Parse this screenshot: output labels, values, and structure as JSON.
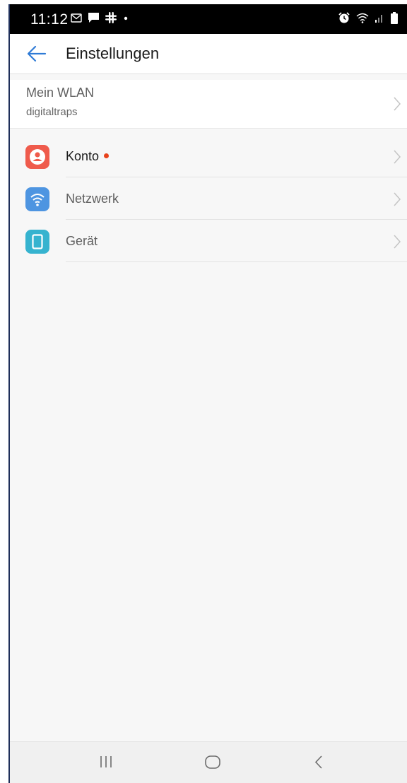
{
  "status_bar": {
    "time": "11:12",
    "left_icons": [
      "gmail-icon",
      "chat-icon",
      "slack-icon",
      "dot-icon"
    ],
    "right_icons": [
      "alarm-icon",
      "wifi-icon",
      "signal-icon",
      "battery-icon"
    ]
  },
  "header": {
    "back_icon": "arrow-left-icon",
    "title": "Einstellungen"
  },
  "wlan": {
    "title": "Mein WLAN",
    "network_name": "digitaltraps"
  },
  "settings_list": [
    {
      "label": "Konto",
      "icon": "account-icon",
      "icon_color": "#ef5b4c",
      "text_color": "#1a1a1a",
      "has_notification_dot": true
    },
    {
      "label": "Netzwerk",
      "icon": "wifi-icon",
      "icon_color": "#4e95e1",
      "text_color": "#5f5f5f",
      "has_notification_dot": false
    },
    {
      "label": "Gerät",
      "icon": "device-icon",
      "icon_color": "#36b3cf",
      "text_color": "#5f5f5f",
      "has_notification_dot": false
    }
  ],
  "nav_bar": {
    "buttons": [
      "recent-apps-icon",
      "home-icon",
      "back-icon"
    ]
  },
  "colors": {
    "accent": "#2f7bd6",
    "notification_dot": "#e8431c",
    "background": "#f7f7f7"
  }
}
